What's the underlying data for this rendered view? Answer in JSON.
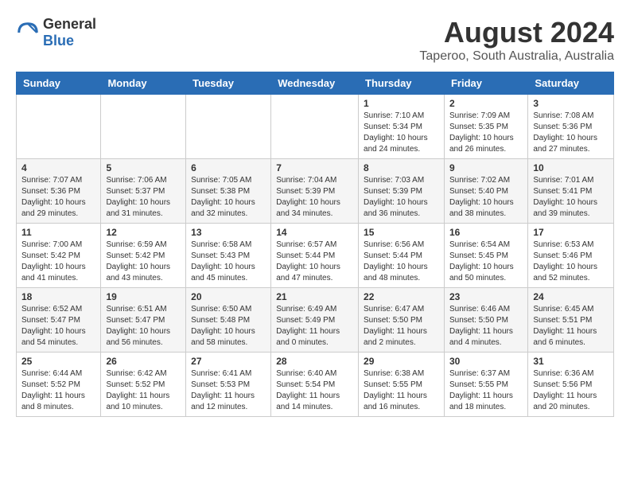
{
  "logo": {
    "general": "General",
    "blue": "Blue"
  },
  "title": "August 2024",
  "location": "Taperoo, South Australia, Australia",
  "days_of_week": [
    "Sunday",
    "Monday",
    "Tuesday",
    "Wednesday",
    "Thursday",
    "Friday",
    "Saturday"
  ],
  "weeks": [
    [
      {
        "day": "",
        "info": ""
      },
      {
        "day": "",
        "info": ""
      },
      {
        "day": "",
        "info": ""
      },
      {
        "day": "",
        "info": ""
      },
      {
        "day": "1",
        "info": "Sunrise: 7:10 AM\nSunset: 5:34 PM\nDaylight: 10 hours\nand 24 minutes."
      },
      {
        "day": "2",
        "info": "Sunrise: 7:09 AM\nSunset: 5:35 PM\nDaylight: 10 hours\nand 26 minutes."
      },
      {
        "day": "3",
        "info": "Sunrise: 7:08 AM\nSunset: 5:36 PM\nDaylight: 10 hours\nand 27 minutes."
      }
    ],
    [
      {
        "day": "4",
        "info": "Sunrise: 7:07 AM\nSunset: 5:36 PM\nDaylight: 10 hours\nand 29 minutes."
      },
      {
        "day": "5",
        "info": "Sunrise: 7:06 AM\nSunset: 5:37 PM\nDaylight: 10 hours\nand 31 minutes."
      },
      {
        "day": "6",
        "info": "Sunrise: 7:05 AM\nSunset: 5:38 PM\nDaylight: 10 hours\nand 32 minutes."
      },
      {
        "day": "7",
        "info": "Sunrise: 7:04 AM\nSunset: 5:39 PM\nDaylight: 10 hours\nand 34 minutes."
      },
      {
        "day": "8",
        "info": "Sunrise: 7:03 AM\nSunset: 5:39 PM\nDaylight: 10 hours\nand 36 minutes."
      },
      {
        "day": "9",
        "info": "Sunrise: 7:02 AM\nSunset: 5:40 PM\nDaylight: 10 hours\nand 38 minutes."
      },
      {
        "day": "10",
        "info": "Sunrise: 7:01 AM\nSunset: 5:41 PM\nDaylight: 10 hours\nand 39 minutes."
      }
    ],
    [
      {
        "day": "11",
        "info": "Sunrise: 7:00 AM\nSunset: 5:42 PM\nDaylight: 10 hours\nand 41 minutes."
      },
      {
        "day": "12",
        "info": "Sunrise: 6:59 AM\nSunset: 5:42 PM\nDaylight: 10 hours\nand 43 minutes."
      },
      {
        "day": "13",
        "info": "Sunrise: 6:58 AM\nSunset: 5:43 PM\nDaylight: 10 hours\nand 45 minutes."
      },
      {
        "day": "14",
        "info": "Sunrise: 6:57 AM\nSunset: 5:44 PM\nDaylight: 10 hours\nand 47 minutes."
      },
      {
        "day": "15",
        "info": "Sunrise: 6:56 AM\nSunset: 5:44 PM\nDaylight: 10 hours\nand 48 minutes."
      },
      {
        "day": "16",
        "info": "Sunrise: 6:54 AM\nSunset: 5:45 PM\nDaylight: 10 hours\nand 50 minutes."
      },
      {
        "day": "17",
        "info": "Sunrise: 6:53 AM\nSunset: 5:46 PM\nDaylight: 10 hours\nand 52 minutes."
      }
    ],
    [
      {
        "day": "18",
        "info": "Sunrise: 6:52 AM\nSunset: 5:47 PM\nDaylight: 10 hours\nand 54 minutes."
      },
      {
        "day": "19",
        "info": "Sunrise: 6:51 AM\nSunset: 5:47 PM\nDaylight: 10 hours\nand 56 minutes."
      },
      {
        "day": "20",
        "info": "Sunrise: 6:50 AM\nSunset: 5:48 PM\nDaylight: 10 hours\nand 58 minutes."
      },
      {
        "day": "21",
        "info": "Sunrise: 6:49 AM\nSunset: 5:49 PM\nDaylight: 11 hours\nand 0 minutes."
      },
      {
        "day": "22",
        "info": "Sunrise: 6:47 AM\nSunset: 5:50 PM\nDaylight: 11 hours\nand 2 minutes."
      },
      {
        "day": "23",
        "info": "Sunrise: 6:46 AM\nSunset: 5:50 PM\nDaylight: 11 hours\nand 4 minutes."
      },
      {
        "day": "24",
        "info": "Sunrise: 6:45 AM\nSunset: 5:51 PM\nDaylight: 11 hours\nand 6 minutes."
      }
    ],
    [
      {
        "day": "25",
        "info": "Sunrise: 6:44 AM\nSunset: 5:52 PM\nDaylight: 11 hours\nand 8 minutes."
      },
      {
        "day": "26",
        "info": "Sunrise: 6:42 AM\nSunset: 5:52 PM\nDaylight: 11 hours\nand 10 minutes."
      },
      {
        "day": "27",
        "info": "Sunrise: 6:41 AM\nSunset: 5:53 PM\nDaylight: 11 hours\nand 12 minutes."
      },
      {
        "day": "28",
        "info": "Sunrise: 6:40 AM\nSunset: 5:54 PM\nDaylight: 11 hours\nand 14 minutes."
      },
      {
        "day": "29",
        "info": "Sunrise: 6:38 AM\nSunset: 5:55 PM\nDaylight: 11 hours\nand 16 minutes."
      },
      {
        "day": "30",
        "info": "Sunrise: 6:37 AM\nSunset: 5:55 PM\nDaylight: 11 hours\nand 18 minutes."
      },
      {
        "day": "31",
        "info": "Sunrise: 6:36 AM\nSunset: 5:56 PM\nDaylight: 11 hours\nand 20 minutes."
      }
    ]
  ]
}
